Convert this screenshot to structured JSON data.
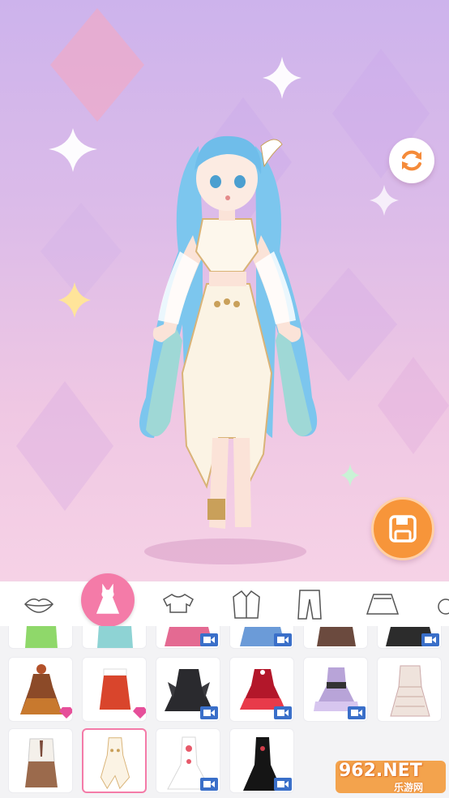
{
  "colors": {
    "accent_pink": "#f47ba8",
    "save_orange": "#f7953a",
    "video_badge_blue": "#3a6fc9",
    "gem_pink": "#e64f9a"
  },
  "toolbar": {
    "refresh_icon": "refresh-icon",
    "save_icon": "save-floppy-icon"
  },
  "category_tabs": [
    {
      "icon": "lips-icon",
      "active": false
    },
    {
      "icon": "dress-icon",
      "active": true
    },
    {
      "icon": "crop-top-icon",
      "active": false
    },
    {
      "icon": "jacket-icon",
      "active": false
    },
    {
      "icon": "pants-icon",
      "active": false
    },
    {
      "icon": "skirt-icon",
      "active": false
    }
  ],
  "items": [
    {
      "name": "green-top",
      "badge": "none"
    },
    {
      "name": "teal-hoodie",
      "badge": "none"
    },
    {
      "name": "pink-plaid-dress",
      "badge": "video"
    },
    {
      "name": "blue-sailor-dress",
      "badge": "video"
    },
    {
      "name": "brown-skirt-outfit",
      "badge": "none"
    },
    {
      "name": "black-frill-dress",
      "badge": "video"
    },
    {
      "name": "brown-lolita-dress",
      "badge": "gem"
    },
    {
      "name": "red-winter-dress",
      "badge": "gem"
    },
    {
      "name": "black-gothic-dress",
      "badge": "video"
    },
    {
      "name": "red-lolita-dress",
      "badge": "video"
    },
    {
      "name": "lavender-lolita-dress",
      "badge": "video"
    },
    {
      "name": "plaid-pinafore-dress",
      "badge": "none"
    },
    {
      "name": "brown-suspender-outfit",
      "badge": "none"
    },
    {
      "name": "white-goddess-dress",
      "badge": "none",
      "selected": true
    },
    {
      "name": "white-mermaid-gown",
      "badge": "video"
    },
    {
      "name": "black-mermaid-gown",
      "badge": "video"
    }
  ],
  "watermark": {
    "logo": "962.NET",
    "sub": "乐游网"
  }
}
